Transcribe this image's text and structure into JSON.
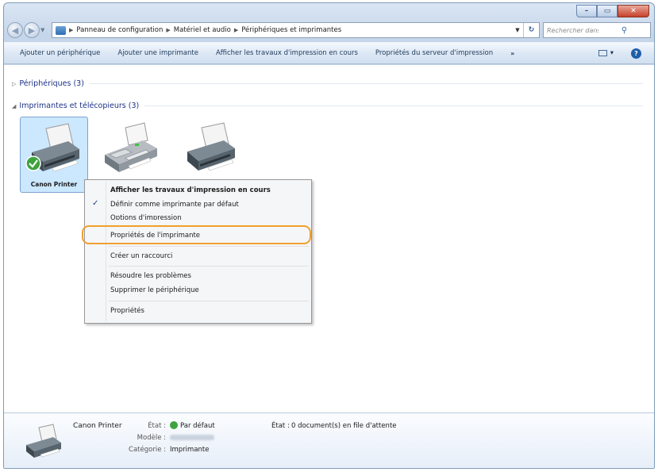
{
  "window": {
    "caption": {
      "minimize": "–",
      "maximize": "▭",
      "close": "✕"
    }
  },
  "address_bar": {
    "crumbs": [
      "Panneau de configuration",
      "Matériel et audio",
      "Périphériques et imprimantes"
    ],
    "search_placeholder": "Rechercher dans : Pé..."
  },
  "command_bar": {
    "commands": [
      "Ajouter un périphérique",
      "Ajouter une imprimante",
      "Afficher les travaux d'impression en cours",
      "Propriétés du serveur d'impression"
    ],
    "more": "»"
  },
  "groups": {
    "devices": {
      "title": "Périphériques (3)",
      "expanded": false
    },
    "printers": {
      "title": "Imprimantes et télécopieurs (3)",
      "expanded": true
    }
  },
  "printers": [
    {
      "label": "Canon Printer",
      "default": true,
      "selected": true
    },
    {
      "label": "",
      "kind": "fax"
    },
    {
      "label": ""
    }
  ],
  "context_menu": {
    "items": [
      {
        "label": "Afficher les travaux d'impression en cours",
        "bold": true
      },
      {
        "label": "Définir comme imprimante par défaut",
        "checked": true
      },
      {
        "label": "Options d'impression"
      },
      {
        "label": "Propriétés de l'imprimante",
        "highlighted": true
      },
      {
        "label": "Créer un raccourci"
      },
      {
        "label": "Résoudre les problèmes"
      },
      {
        "label": "Supprimer le périphérique"
      },
      {
        "label": "Propriétés"
      }
    ],
    "highlight_color": "#f0a030"
  },
  "details": {
    "name": "Canon Printer",
    "state_label": "État :",
    "state_value": "Par défaut",
    "model_label": "Modèle :",
    "category_label": "Catégorie :",
    "category_value": "Imprimante",
    "queue_label": "État :",
    "queue_value": "0 document(s) en file d'attente"
  },
  "colors": {
    "selection": "#cce8ff",
    "accent": "#1e3287"
  }
}
